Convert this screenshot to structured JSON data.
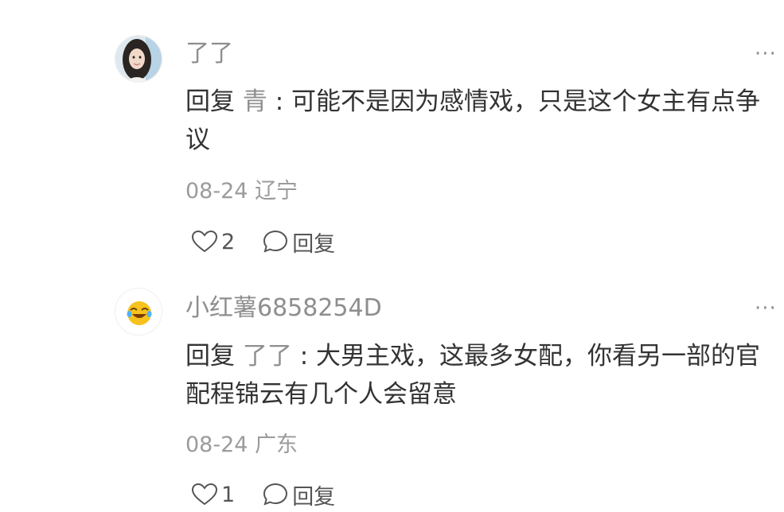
{
  "comments": [
    {
      "username": "了了",
      "reply_prefix": "回复",
      "reply_target": "青",
      "reply_sep": " : ",
      "text": "可能不是因为感情戏，只是这个女主有点争议",
      "date": "08-24",
      "location": "辽宁",
      "likes": "2",
      "reply_label": "回复",
      "more": "···",
      "avatar": "portrait-photo"
    },
    {
      "username": "小红薯6858254D",
      "reply_prefix": "回复",
      "reply_target": "了了",
      "reply_sep": " : ",
      "text": "大男主戏，这最多女配，你看另一部的官配程锦云有几个人会留意",
      "date": "08-24",
      "location": "广东",
      "likes": "1",
      "reply_label": "回复",
      "more": "···",
      "avatar": "laughing-emoji"
    }
  ],
  "colors": {
    "text": "#333333",
    "muted": "#8e8e8e",
    "meta": "#9b9b9b"
  }
}
